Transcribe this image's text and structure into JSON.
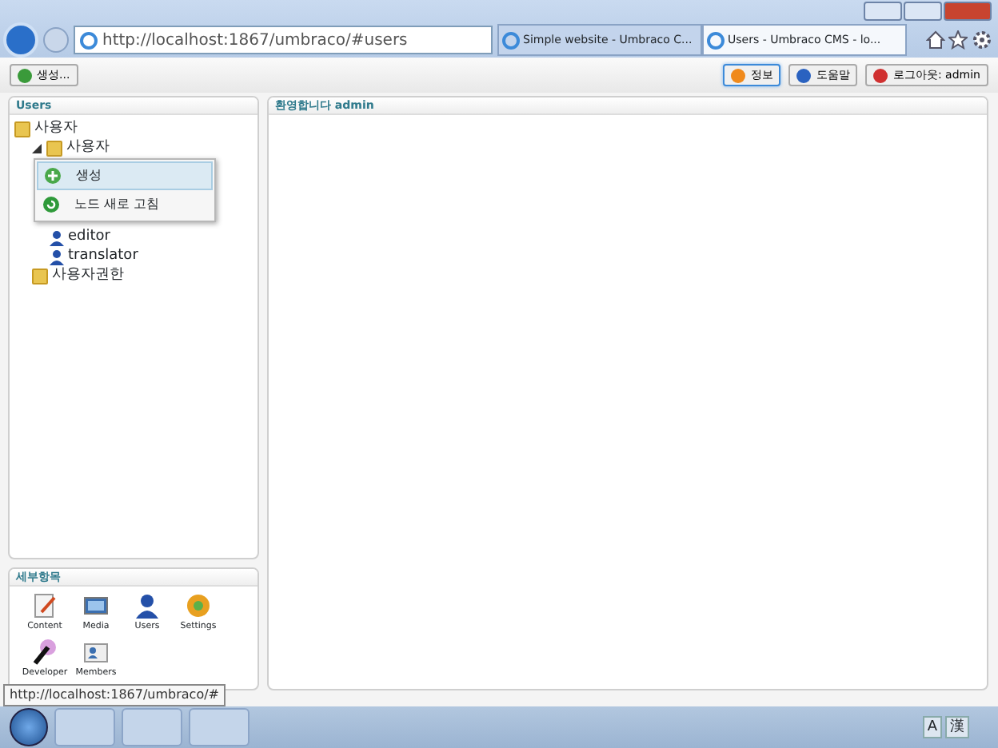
{
  "browser": {
    "address": "http://localhost:1867/umbraco/#users",
    "tabs": [
      {
        "title": "Simple website - Umbraco C...",
        "selected": false
      },
      {
        "title": "Users - Umbraco CMS - lo...",
        "selected": true
      }
    ]
  },
  "toolbar": {
    "create_button": "생성...",
    "buttons": [
      {
        "label": "정보",
        "kind": "info",
        "selected": true
      },
      {
        "label": "도움말",
        "kind": "help",
        "selected": false
      },
      {
        "label": "로그아웃: admin",
        "kind": "logout",
        "selected": false
      }
    ]
  },
  "tree": {
    "title": "Users",
    "items": [
      {
        "label": "사용자",
        "kind": "folder",
        "children": [
          {
            "label": "사용자",
            "kind": "folder",
            "expanded": true,
            "children": [
              {
                "label": "editor",
                "kind": "user"
              },
              {
                "label": "translator",
                "kind": "user"
              }
            ]
          },
          {
            "label": "사용자권한",
            "kind": "folder"
          }
        ]
      }
    ]
  },
  "context_menu": [
    {
      "label": "생성",
      "kind": "create",
      "selected": true
    },
    {
      "label": "노드 새로 고침",
      "kind": "refresh",
      "selected": false
    }
  ],
  "sections": {
    "title": "세부항목",
    "items": [
      {
        "label": "Content",
        "kind": "content"
      },
      {
        "label": "Media",
        "kind": "media"
      },
      {
        "label": "Users",
        "kind": "users"
      },
      {
        "label": "Settings",
        "kind": "settings"
      },
      {
        "label": "Developer",
        "kind": "developer"
      },
      {
        "label": "Members",
        "kind": "members"
      }
    ]
  },
  "main_panel": {
    "title": "환영합니다 admin"
  },
  "status_tooltip": "http://localhost:1867/umbraco/#",
  "tray": [
    "A",
    "漢"
  ]
}
